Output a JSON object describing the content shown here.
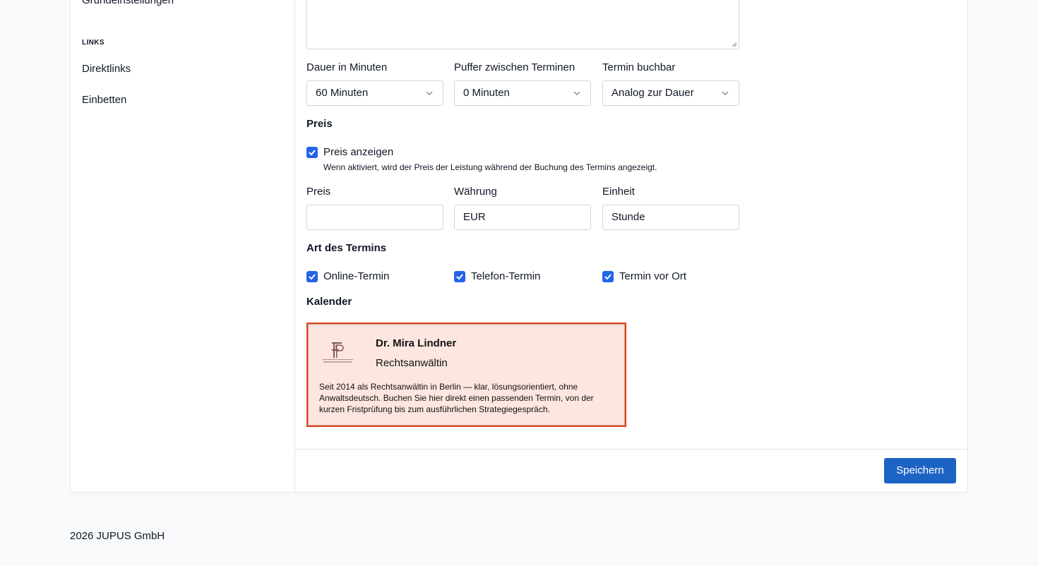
{
  "sidebar": {
    "cut_item": "Grundeinstellungen",
    "section_label": "LINKS",
    "links": [
      "Direktlinks",
      "Einbetten"
    ]
  },
  "form": {
    "duration": {
      "label": "Dauer in Minuten",
      "value": "60 Minuten"
    },
    "buffer": {
      "label": "Puffer zwischen Terminen",
      "value": "0 Minuten"
    },
    "bookable": {
      "label": "Termin buchbar",
      "value": "Analog zur Dauer"
    },
    "price_section": {
      "heading": "Preis",
      "show_price_label": "Preis anzeigen",
      "show_price_checked": true,
      "show_price_hint": "Wenn aktiviert, wird der Preis der Leistung während der Buchung des Termins angezeigt.",
      "price_label": "Preis",
      "price_value": "",
      "currency_label": "Währung",
      "currency_value": "EUR",
      "unit_label": "Einheit",
      "unit_value": "Stunde"
    },
    "appointment_type": {
      "heading": "Art des Termins",
      "options": [
        {
          "label": "Online-Termin",
          "checked": true
        },
        {
          "label": "Telefon-Termin",
          "checked": true
        },
        {
          "label": "Termin vor Ort",
          "checked": true
        }
      ]
    },
    "calendar": {
      "heading": "Kalender",
      "card": {
        "name": "Dr. Mira Lindner",
        "role": "Rechtsanwältin",
        "description": "Seit 2014 als Rechtsanwältin in Berlin — klar, lösungsorientiert, ohne Anwaltsdeutsch. Buchen Sie hier direkt einen passenden Termin, von der kurzen Fristprüfung bis zum ausführlichen Strategiegespräch.",
        "accent_color": "#e0441c",
        "background_color": "#fce6df"
      }
    }
  },
  "actions": {
    "save_label": "Speichern",
    "save_color": "#1d63c4"
  },
  "footer": {
    "copyright": "2026 JUPUS GmbH"
  }
}
